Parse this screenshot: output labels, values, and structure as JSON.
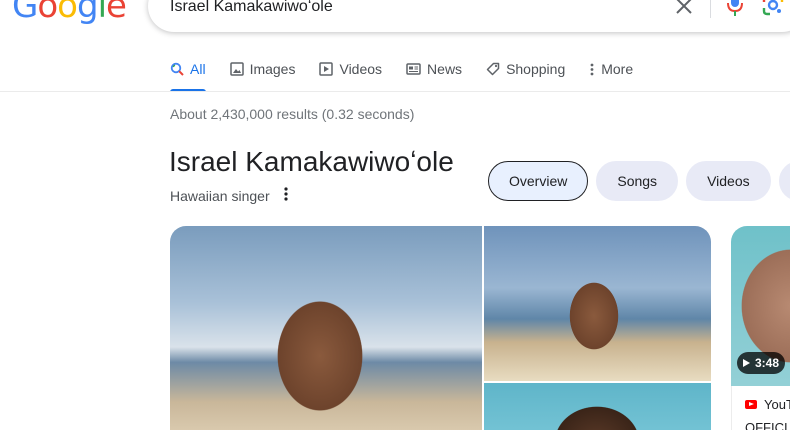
{
  "logo": {
    "letters": [
      "G",
      "o",
      "o",
      "g",
      "l",
      "e"
    ],
    "colors": [
      "#4285F4",
      "#EA4335",
      "#FBBC05",
      "#4285F4",
      "#34A853",
      "#EA4335"
    ]
  },
  "search": {
    "query": "Israel Kamakawiwoʻole"
  },
  "tabs": [
    {
      "label": "All",
      "icon": "search-icon",
      "active": true
    },
    {
      "label": "Images",
      "icon": "image-icon"
    },
    {
      "label": "Videos",
      "icon": "video-icon"
    },
    {
      "label": "News",
      "icon": "news-icon"
    },
    {
      "label": "Shopping",
      "icon": "tag-icon"
    },
    {
      "label": "More",
      "icon": "more-vert-icon"
    }
  ],
  "results": {
    "stats": "About 2,430,000 results (0.32 seconds)"
  },
  "entity": {
    "title": "Israel Kamakawiwoʻole",
    "subtitle": "Hawaiian singer",
    "chips": [
      "Overview",
      "Songs",
      "Videos"
    ]
  },
  "video": {
    "duration": "3:48",
    "source": "YouT",
    "title": "OFFICI"
  },
  "colors": {
    "accent": "#1a73e8",
    "chip_bg": "#e8eaf6"
  }
}
